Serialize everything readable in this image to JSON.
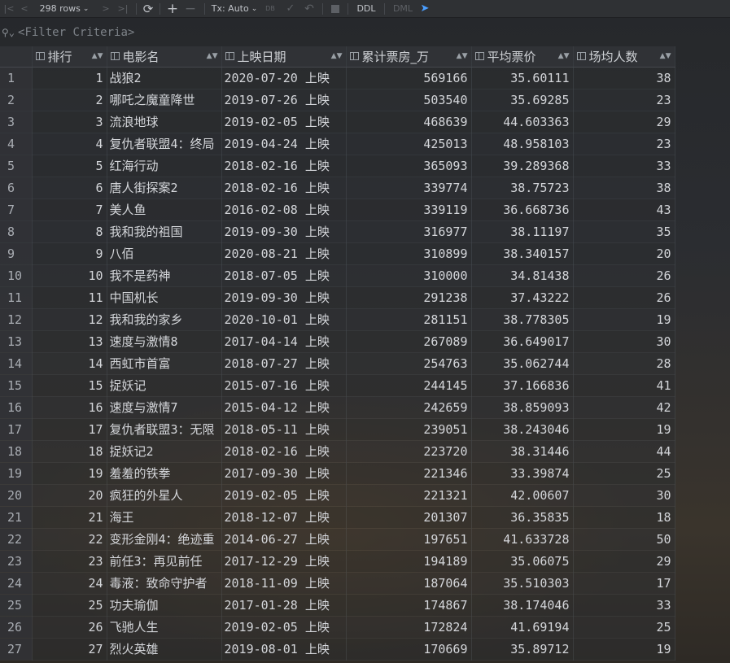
{
  "toolbar": {
    "rows_label": "298 rows",
    "tx_label": "Tx: Auto",
    "ddl_label": "DDL",
    "dml_label": "DML"
  },
  "filter": {
    "placeholder": "<Filter Criteria>"
  },
  "columns": [
    "排行",
    "电影名",
    "上映日期",
    "累计票房_万",
    "平均票价",
    "场均人数"
  ],
  "rows": [
    [
      "1",
      "1",
      "战狼2",
      "2020-07-20 上映",
      "569166",
      "35.60111",
      "38"
    ],
    [
      "2",
      "2",
      "哪吒之魔童降世",
      "2019-07-26 上映",
      "503540",
      "35.69285",
      "23"
    ],
    [
      "3",
      "3",
      "流浪地球",
      "2019-02-05 上映",
      "468639",
      "44.603363",
      "29"
    ],
    [
      "4",
      "4",
      "复仇者联盟4：终局",
      "2019-04-24 上映",
      "425013",
      "48.958103",
      "23"
    ],
    [
      "5",
      "5",
      "红海行动",
      "2018-02-16 上映",
      "365093",
      "39.289368",
      "33"
    ],
    [
      "6",
      "6",
      "唐人街探案2",
      "2018-02-16 上映",
      "339774",
      "38.75723",
      "38"
    ],
    [
      "7",
      "7",
      "美人鱼",
      "2016-02-08 上映",
      "339119",
      "36.668736",
      "43"
    ],
    [
      "8",
      "8",
      "我和我的祖国",
      "2019-09-30 上映",
      "316977",
      "38.11197",
      "35"
    ],
    [
      "9",
      "9",
      "八佰",
      "2020-08-21 上映",
      "310899",
      "38.340157",
      "20"
    ],
    [
      "10",
      "10",
      "我不是药神",
      "2018-07-05 上映",
      "310000",
      "34.81438",
      "26"
    ],
    [
      "11",
      "11",
      "中国机长",
      "2019-09-30 上映",
      "291238",
      "37.43222",
      "26"
    ],
    [
      "12",
      "12",
      "我和我的家乡",
      "2020-10-01 上映",
      "281151",
      "38.778305",
      "19"
    ],
    [
      "13",
      "13",
      "速度与激情8",
      "2017-04-14 上映",
      "267089",
      "36.649017",
      "30"
    ],
    [
      "14",
      "14",
      "西虹市首富",
      "2018-07-27 上映",
      "254763",
      "35.062744",
      "28"
    ],
    [
      "15",
      "15",
      "捉妖记",
      "2015-07-16 上映",
      "244145",
      "37.166836",
      "41"
    ],
    [
      "16",
      "16",
      "速度与激情7",
      "2015-04-12 上映",
      "242659",
      "38.859093",
      "42"
    ],
    [
      "17",
      "17",
      "复仇者联盟3：无限",
      "2018-05-11 上映",
      "239051",
      "38.243046",
      "19"
    ],
    [
      "18",
      "18",
      "捉妖记2",
      "2018-02-16 上映",
      "223720",
      "38.31446",
      "44"
    ],
    [
      "19",
      "19",
      "羞羞的铁拳",
      "2017-09-30 上映",
      "221346",
      "33.39874",
      "25"
    ],
    [
      "20",
      "20",
      "疯狂的外星人",
      "2019-02-05 上映",
      "221321",
      "42.00607",
      "30"
    ],
    [
      "21",
      "21",
      "海王",
      "2018-12-07 上映",
      "201307",
      "36.35835",
      "18"
    ],
    [
      "22",
      "22",
      "变形金刚4：绝迹重",
      "2014-06-27 上映",
      "197651",
      "41.633728",
      "50"
    ],
    [
      "23",
      "23",
      "前任3：再见前任",
      "2017-12-29 上映",
      "194189",
      "35.06075",
      "29"
    ],
    [
      "24",
      "24",
      "毒液：致命守护者",
      "2018-11-09 上映",
      "187064",
      "35.510303",
      "17"
    ],
    [
      "25",
      "25",
      "功夫瑜伽",
      "2017-01-28 上映",
      "174867",
      "38.174046",
      "33"
    ],
    [
      "26",
      "26",
      "飞驰人生",
      "2019-02-05 上映",
      "172824",
      "41.69194",
      "25"
    ],
    [
      "27",
      "27",
      "烈火英雄",
      "2019-08-01 上映",
      "170669",
      "35.89712",
      "19"
    ]
  ]
}
